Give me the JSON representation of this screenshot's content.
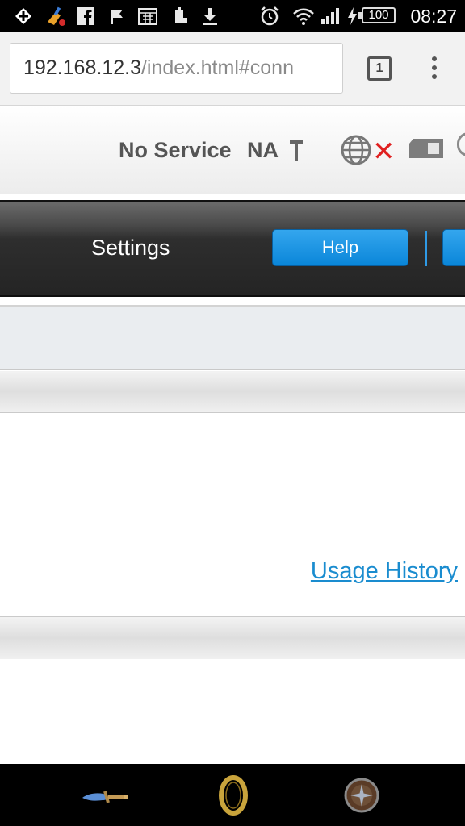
{
  "status_bar": {
    "time": "08:27",
    "battery": "100",
    "icons": [
      "add-icon",
      "cleaner-icon",
      "facebook-icon",
      "flag-icon",
      "calendar-icon",
      "battery-saver-icon",
      "download-icon",
      "alarm-icon",
      "wifi-icon",
      "signal-icon",
      "charging-icon"
    ]
  },
  "browser": {
    "url_host": "192.168.12.3",
    "url_path": "/index.html#conn",
    "tab_count": "1"
  },
  "router_status": {
    "service": "No Service",
    "network_type": "NA"
  },
  "nav": {
    "settings_label": "Settings",
    "help_label": "Help"
  },
  "content": {
    "usage_history_link": "Usage History"
  },
  "dock": {
    "items": [
      "sword-icon",
      "ring-icon",
      "shield-icon"
    ]
  },
  "colors": {
    "accent_blue": "#1a8ccf",
    "help_button": "#0a86d9",
    "error_red": "#e02020"
  }
}
